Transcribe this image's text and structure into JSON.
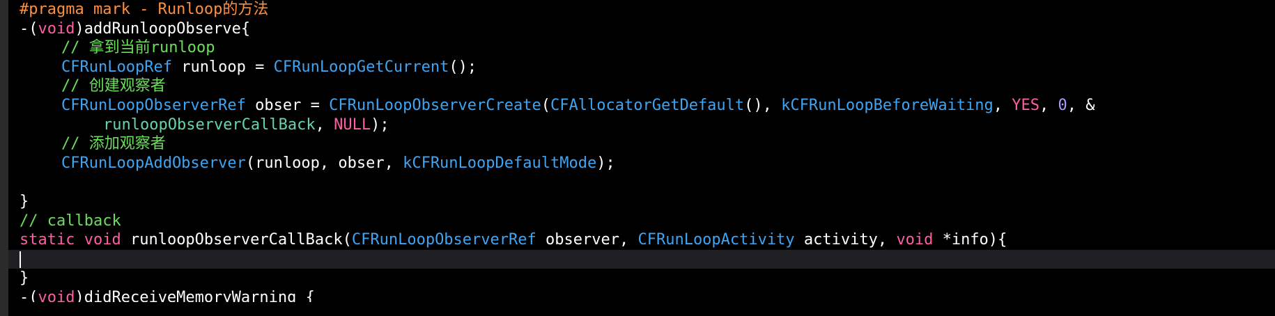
{
  "editor": {
    "lines": [
      {
        "segments": [
          {
            "text": "#pragma mark - Runloop的方法",
            "kind": "pp"
          }
        ]
      },
      {
        "segments": [
          {
            "text": "-(",
            "kind": "pl"
          },
          {
            "text": "void",
            "kind": "kw"
          },
          {
            "text": ")addRunloopObserve{",
            "kind": "pl"
          }
        ]
      },
      {
        "indent": 1,
        "segments": [
          {
            "text": "// 拿到当前runloop",
            "kind": "cmt"
          }
        ]
      },
      {
        "indent": 1,
        "segments": [
          {
            "text": "CFRunLoopRef",
            "kind": "ty"
          },
          {
            "text": " runloop = ",
            "kind": "pl"
          },
          {
            "text": "CFRunLoopGetCurrent",
            "kind": "fn"
          },
          {
            "text": "();",
            "kind": "pl"
          }
        ]
      },
      {
        "indent": 1,
        "segments": [
          {
            "text": "// 创建观察者",
            "kind": "cmt"
          }
        ]
      },
      {
        "indent": 1,
        "segments": [
          {
            "text": "CFRunLoopObserverRef",
            "kind": "ty"
          },
          {
            "text": " obser = ",
            "kind": "pl"
          },
          {
            "text": "CFRunLoopObserverCreate",
            "kind": "fn"
          },
          {
            "text": "(",
            "kind": "pl"
          },
          {
            "text": "CFAllocatorGetDefault",
            "kind": "fn"
          },
          {
            "text": "(), ",
            "kind": "pl"
          },
          {
            "text": "kCFRunLoopBeforeWaiting",
            "kind": "fn"
          },
          {
            "text": ", ",
            "kind": "pl"
          },
          {
            "text": "YES",
            "kind": "kw"
          },
          {
            "text": ", ",
            "kind": "pl"
          },
          {
            "text": "0",
            "kind": "num"
          },
          {
            "text": ", &",
            "kind": "pl"
          }
        ]
      },
      {
        "indent": 2,
        "segments": [
          {
            "text": "runloopObserverCallBack",
            "kind": "user"
          },
          {
            "text": ", ",
            "kind": "pl"
          },
          {
            "text": "NULL",
            "kind": "kw"
          },
          {
            "text": ");",
            "kind": "pl"
          }
        ]
      },
      {
        "indent": 1,
        "segments": [
          {
            "text": "// 添加观察者",
            "kind": "cmt"
          }
        ]
      },
      {
        "indent": 1,
        "segments": [
          {
            "text": "CFRunLoopAddObserver",
            "kind": "fn"
          },
          {
            "text": "(runloop, obser, ",
            "kind": "pl"
          },
          {
            "text": "kCFRunLoopDefaultMode",
            "kind": "fn"
          },
          {
            "text": ");",
            "kind": "pl"
          }
        ]
      },
      {
        "segments": []
      },
      {
        "segments": [
          {
            "text": "}",
            "kind": "pl"
          }
        ]
      },
      {
        "segments": [
          {
            "text": "// callback",
            "kind": "cmt"
          }
        ]
      },
      {
        "segments": [
          {
            "text": "static",
            "kind": "kw"
          },
          {
            "text": " ",
            "kind": "pl"
          },
          {
            "text": "void",
            "kind": "kw"
          },
          {
            "text": " runloopObserverCallBack(",
            "kind": "pl"
          },
          {
            "text": "CFRunLoopObserverRef",
            "kind": "ty"
          },
          {
            "text": " observer, ",
            "kind": "pl"
          },
          {
            "text": "CFRunLoopActivity",
            "kind": "ty"
          },
          {
            "text": " activity, ",
            "kind": "pl"
          },
          {
            "text": "void",
            "kind": "kw"
          },
          {
            "text": " *info){",
            "kind": "pl"
          }
        ]
      },
      {
        "current": true,
        "segments": []
      },
      {
        "segments": [
          {
            "text": "}",
            "kind": "pl"
          }
        ]
      },
      {
        "clipped": true,
        "segments": [
          {
            "text": "-(",
            "kind": "pl"
          },
          {
            "text": "void",
            "kind": "kw"
          },
          {
            "text": ")didReceiveMemoryWarning {",
            "kind": "pl"
          }
        ]
      }
    ]
  },
  "colors": {
    "background": "#000000",
    "preprocessor": "#fd8f3f",
    "keyword": "#fc5fa3",
    "comment": "#6bdf5c",
    "type": "#3fa4f2",
    "user_function": "#67d4a9",
    "number": "#a79df5",
    "plain": "#ffffff"
  }
}
